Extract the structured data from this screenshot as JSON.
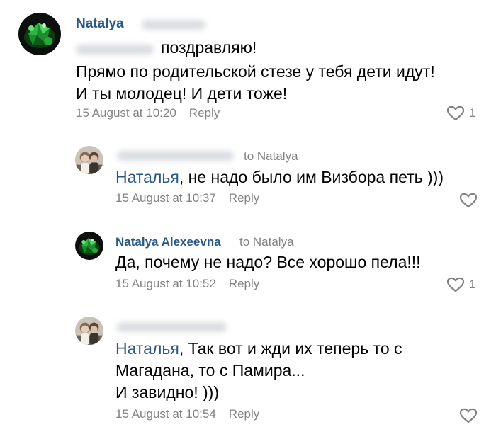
{
  "comments": [
    {
      "author": "Natalya",
      "lines_prefix": "поздравляю!",
      "line2": "Прямо по родительской стезе у тебя дети идут!",
      "line3": "И ты молодец! И дети тоже!",
      "date": "15 August at 10:20",
      "reply": "Reply",
      "likes": "1",
      "avatar": "emerald-avatar"
    },
    {
      "author": "",
      "to": "to Natalya",
      "mention": "Наталья",
      "text": ", не надо было им Визбора петь )))",
      "date": "15 August at 10:37",
      "reply": "Reply",
      "likes": "",
      "avatar": "couple-photo-avatar"
    },
    {
      "author": "Natalya Alexeevna",
      "to": "to Natalya",
      "text": "Да, почему не надо? Все хорошо пела!!!",
      "date": "15 August at 10:52",
      "reply": "Reply",
      "likes": "1",
      "avatar": "emerald-avatar"
    },
    {
      "author": "",
      "mention": "Наталья",
      "line1": ", Так вот и жди их теперь то с",
      "line2": "Магадана, то с Памира...",
      "line3": "И завидно! )))",
      "date": "15 August at 10:54",
      "reply": "Reply",
      "likes": "",
      "avatar": "couple-photo-avatar"
    }
  ],
  "colors": {
    "link": "#2a5885",
    "meta": "#828282",
    "avatar_green": "#1f7a2a"
  }
}
